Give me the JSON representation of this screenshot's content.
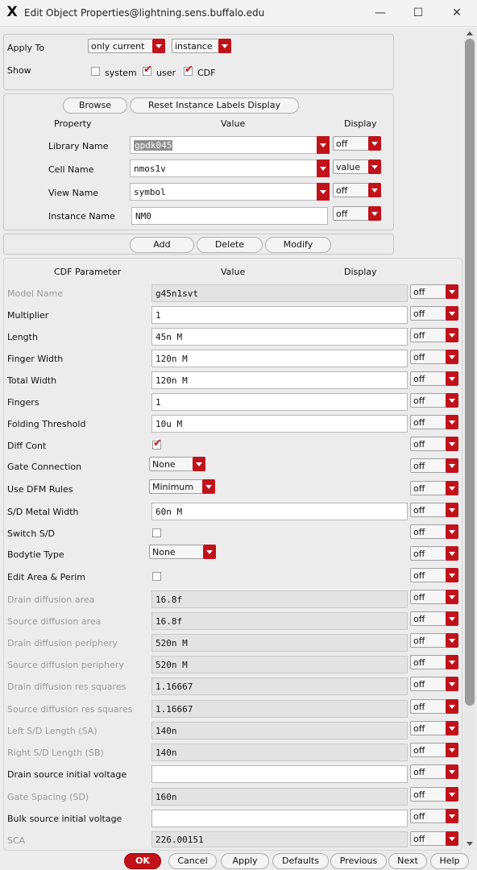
{
  "window": {
    "title": "Edit Object Properties@lightning.sens.buffalo.edu",
    "app_icon": "X",
    "minimize_glyph": "—",
    "maximize_glyph": "☐",
    "close_glyph": "✕"
  },
  "apply_to": {
    "label": "Apply To",
    "scope": "only current",
    "target": "instance"
  },
  "show": {
    "label": "Show",
    "options": [
      {
        "label": "system",
        "checked": false
      },
      {
        "label": "user",
        "checked": true
      },
      {
        "label": "CDF",
        "checked": true
      }
    ]
  },
  "instance_panel": {
    "browse_label": "Browse",
    "reset_label": "Reset Instance Labels Display",
    "col_property": "Property",
    "col_value": "Value",
    "col_display": "Display",
    "rows": [
      {
        "property": "Library Name",
        "value": "gpdk045",
        "display": "off"
      },
      {
        "property": "Cell Name",
        "value": "nmos1v",
        "display": "value"
      },
      {
        "property": "View Name",
        "value": "symbol",
        "display": "off"
      },
      {
        "property": "Instance Name",
        "value": "NM0",
        "display": "off"
      }
    ]
  },
  "actions": {
    "add": "Add",
    "delete": "Delete",
    "modify": "Modify"
  },
  "cdf": {
    "col_param": "CDF Parameter",
    "col_value": "Value",
    "col_display": "Display",
    "rows": [
      {
        "name": "Model Name",
        "value": "g45n1svt",
        "display": "off"
      },
      {
        "name": "Multiplier",
        "value": "1",
        "display": "off"
      },
      {
        "name": "Length",
        "value": "45n M",
        "display": "off"
      },
      {
        "name": "Finger Width",
        "value": "120n M",
        "display": "off"
      },
      {
        "name": "Total Width",
        "value": "120n M",
        "display": "off"
      },
      {
        "name": "Fingers",
        "value": "1",
        "display": "off"
      },
      {
        "name": "Folding Threshold",
        "value": "10u M",
        "display": "off"
      },
      {
        "name": "Diff Cont",
        "value": "",
        "checked": true,
        "display": "off"
      },
      {
        "name": "Gate Connection",
        "value": "None",
        "display": "off"
      },
      {
        "name": "Use DFM Rules",
        "value": "Minimum",
        "display": "off"
      },
      {
        "name": "S/D Metal Width",
        "value": "60n M",
        "display": "off"
      },
      {
        "name": "Switch S/D",
        "value": "",
        "checked": false,
        "display": "off"
      },
      {
        "name": "Bodytie Type",
        "value": "None",
        "display": "off"
      },
      {
        "name": "Edit Area & Perim",
        "value": "",
        "checked": false,
        "display": "off"
      },
      {
        "name": "Drain diffusion area",
        "value": "16.8f",
        "display": "off"
      },
      {
        "name": "Source diffusion area",
        "value": "16.8f",
        "display": "off"
      },
      {
        "name": "Drain diffusion periphery",
        "value": "520n M",
        "display": "off"
      },
      {
        "name": "Source diffusion periphery",
        "value": "520n M",
        "display": "off"
      },
      {
        "name": "Drain diffusion res squares",
        "value": "1.16667",
        "display": "off"
      },
      {
        "name": "Source diffusion res squares",
        "value": "1.16667",
        "display": "off"
      },
      {
        "name": "Left S/D Length (SA)",
        "value": "140n",
        "display": "off"
      },
      {
        "name": "Right S/D Length (SB)",
        "value": "140n",
        "display": "off"
      },
      {
        "name": "Drain source initial voltage",
        "value": "",
        "display": "off"
      },
      {
        "name": "Gate Spacing (SD)",
        "value": "160n",
        "display": "off"
      },
      {
        "name": "Bulk source initial voltage",
        "value": "",
        "display": "off"
      },
      {
        "name": "SCA",
        "value": "226.00151",
        "display": "off"
      }
    ]
  },
  "footer": {
    "ok": "OK",
    "cancel": "Cancel",
    "apply": "Apply",
    "defaults": "Defaults",
    "previous": "Previous",
    "next": "Next",
    "help": "Help"
  },
  "colors": {
    "accent": "#c1121a"
  }
}
